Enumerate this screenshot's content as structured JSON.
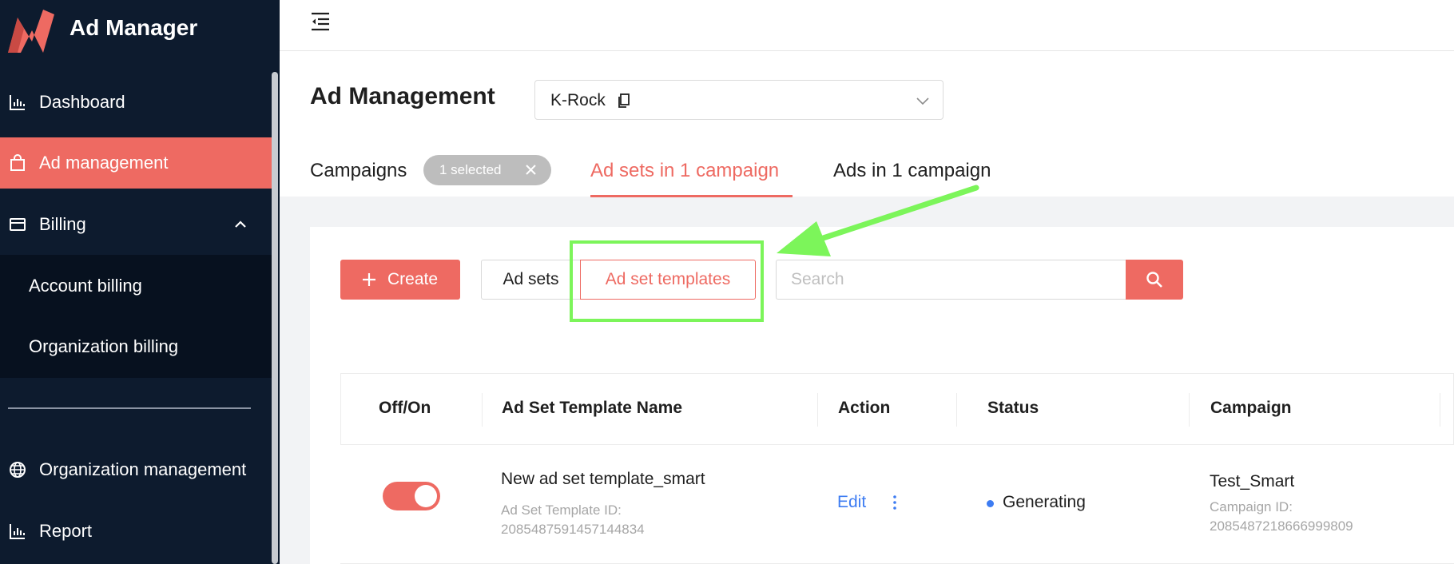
{
  "app": {
    "title": "Ad Manager"
  },
  "colors": {
    "accent": "#ee6a62",
    "sidebar_bg": "#0d1b2e",
    "highlight": "#7cf55a",
    "link": "#3d7cf2"
  },
  "sidebar": {
    "items": [
      {
        "label": "Dashboard",
        "icon": "bar-chart-icon"
      },
      {
        "label": "Ad management",
        "icon": "shopping-bag-icon",
        "active": true
      },
      {
        "label": "Billing",
        "icon": "credit-card-icon",
        "expanded": true
      },
      {
        "label": "Organization management",
        "icon": "globe-icon"
      },
      {
        "label": "Report",
        "icon": "bar-chart-icon"
      }
    ],
    "billing_children": [
      "Account billing",
      "Organization billing"
    ]
  },
  "header": {
    "page_title": "Ad Management",
    "account": "K-Rock"
  },
  "tabs": {
    "campaigns": "Campaigns",
    "selected_chip": "1 selected",
    "ad_sets": "Ad sets in 1 campaign",
    "ads": "Ads in 1 campaign"
  },
  "toolbar": {
    "create_label": "Create",
    "segment_ad_sets": "Ad sets",
    "segment_templates": "Ad set templates",
    "search_placeholder": "Search"
  },
  "table": {
    "columns": [
      "Off/On",
      "Ad Set Template Name",
      "Action",
      "Status",
      "Campaign"
    ],
    "rows": [
      {
        "enabled": true,
        "name": "New ad set template_smart",
        "id_label": "Ad Set Template ID:",
        "id": "2085487591457144834",
        "action_edit": "Edit",
        "status": "Generating",
        "campaign": "Test_Smart",
        "campaign_id_label": "Campaign ID:",
        "campaign_id": "2085487218666999809"
      }
    ]
  }
}
